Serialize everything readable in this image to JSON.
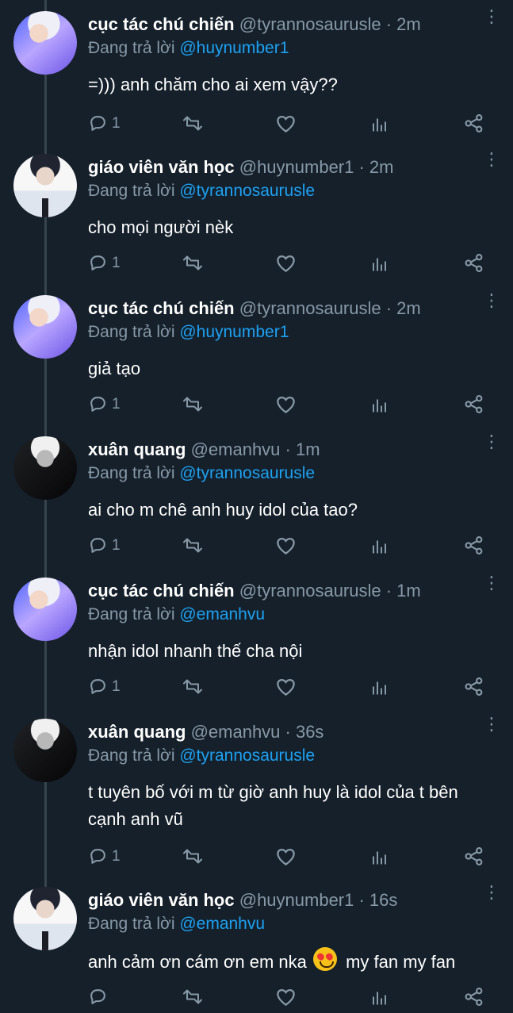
{
  "tweets": [
    {
      "name": "cục tác chú chiến",
      "meta": "@tyrannosaurusle · 2m",
      "reply_prefix": "Đang trả lời ",
      "reply_to": "@huynumber1",
      "text": "=))) anh chăm cho ai xem vậy??",
      "reply_count": "1"
    },
    {
      "name": "giáo viên văn học",
      "meta": "@huynumber1 · 2m",
      "reply_prefix": "Đang trả lời ",
      "reply_to": "@tyrannosaurusle",
      "text": "cho mọi người nèk",
      "reply_count": "1"
    },
    {
      "name": "cục tác chú chiến",
      "meta": "@tyrannosaurusle · 2m",
      "reply_prefix": "Đang trả lời ",
      "reply_to": "@huynumber1",
      "text": "giả tạo",
      "reply_count": "1"
    },
    {
      "name": "xuân quang",
      "meta": "@emanhvu · 1m",
      "reply_prefix": "Đang trả lời ",
      "reply_to": "@tyrannosaurusle",
      "text": "ai cho m chê anh huy idol của tao?",
      "reply_count": "1"
    },
    {
      "name": "cục tác chú chiến",
      "meta": "@tyrannosaurusle · 1m",
      "reply_prefix": "Đang trả lời ",
      "reply_to": "@emanhvu",
      "text": "nhận idol nhanh thế cha nội",
      "reply_count": "1"
    },
    {
      "name": "xuân quang",
      "meta": "@emanhvu · 36s",
      "reply_prefix": "Đang trả lời ",
      "reply_to": "@tyrannosaurusle",
      "text": "t tuyên bố với m từ giờ anh huy là idol của t bên cạnh anh vũ",
      "reply_count": "1"
    },
    {
      "name": "giáo viên văn học",
      "meta": "@huynumber1 · 16s",
      "reply_prefix": "Đang trả lời ",
      "reply_to": "@emanhvu",
      "text_before_emoji": "anh cảm ơn cám ơn em nka",
      "emoji": "smiling-face-with-heart-eyes",
      "text_after_emoji": "my fan my fan",
      "reply_count": ""
    }
  ],
  "icons": {
    "reply": "reply-icon",
    "retweet": "retweet-icon",
    "like": "like-icon",
    "stats": "analytics-icon",
    "share": "share-icon",
    "more": "more-options-icon"
  },
  "colors": {
    "background": "#15202b",
    "muted": "#8899a6",
    "mention": "#1da1f2",
    "thread_line": "#38444d"
  }
}
